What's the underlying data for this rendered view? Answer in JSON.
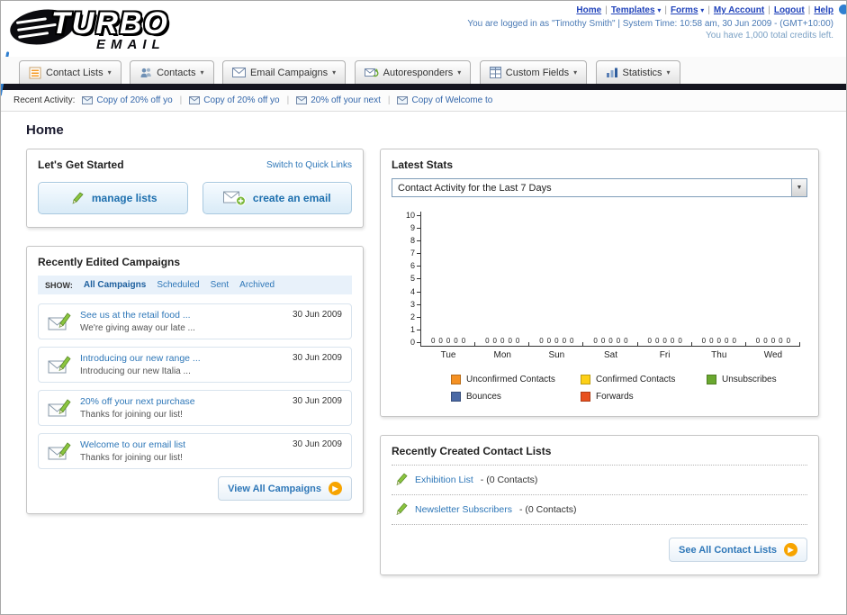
{
  "header": {
    "logo_line1": "TURBO",
    "logo_line2": "EMAIL",
    "nav": {
      "items": [
        "Home",
        "Templates",
        "Forms",
        "My Account",
        "Logout",
        "Help"
      ]
    },
    "login_info": "You are logged in as \"Timothy Smith\" | System Time: 10:58 am, 30 Jun 2009 - (GMT+10:00)",
    "credits": "You have 1,000 total credits left."
  },
  "toolbar": {
    "tabs": [
      {
        "label": "Contact Lists"
      },
      {
        "label": "Contacts"
      },
      {
        "label": "Email Campaigns"
      },
      {
        "label": "Autoresponders"
      },
      {
        "label": "Custom Fields"
      },
      {
        "label": "Statistics"
      }
    ]
  },
  "recent_activity": {
    "label": "Recent Activity:",
    "items": [
      "Copy of 20% off yo",
      "Copy of 20% off yo",
      "20% off your next",
      "Copy of Welcome to"
    ]
  },
  "page": {
    "title": "Home"
  },
  "get_started": {
    "title": "Let's Get Started",
    "switch_link": "Switch to Quick Links",
    "manage_lists_label": "manage lists",
    "create_email_label": "create an email"
  },
  "campaigns": {
    "title": "Recently Edited Campaigns",
    "show_label": "SHOW:",
    "filters": [
      "All Campaigns",
      "Scheduled",
      "Sent",
      "Archived"
    ],
    "active_filter": "All Campaigns",
    "items": [
      {
        "title": "See us at the retail food ...",
        "subtitle": "We're giving away our late ...",
        "date": "30 Jun 2009"
      },
      {
        "title": "Introducing our new range ...",
        "subtitle": "Introducing our new Italia ...",
        "date": "30 Jun 2009"
      },
      {
        "title": "20% off your next purchase",
        "subtitle": "Thanks for joining our list!",
        "date": "30 Jun 2009"
      },
      {
        "title": "Welcome to our email list",
        "subtitle": "Thanks for joining our list!",
        "date": "30 Jun 2009"
      }
    ],
    "view_all_label": "View All Campaigns"
  },
  "stats": {
    "title": "Latest Stats",
    "period_selector": "Contact Activity for the Last 7 Days",
    "chart_data": {
      "type": "bar",
      "title": "Contact Activity for the Last 7 Days",
      "categories": [
        "Tue",
        "Mon",
        "Sun",
        "Sat",
        "Fri",
        "Thu",
        "Wed"
      ],
      "series": [
        {
          "name": "Unconfirmed Contacts",
          "color": "#f59123",
          "values": [
            0,
            0,
            0,
            0,
            0,
            0,
            0
          ]
        },
        {
          "name": "Confirmed Contacts",
          "color": "#fdd017",
          "values": [
            0,
            0,
            0,
            0,
            0,
            0,
            0
          ]
        },
        {
          "name": "Unsubscribes",
          "color": "#6aa82f",
          "values": [
            0,
            0,
            0,
            0,
            0,
            0,
            0
          ]
        },
        {
          "name": "Bounces",
          "color": "#4a69a5",
          "values": [
            0,
            0,
            0,
            0,
            0,
            0,
            0
          ]
        },
        {
          "name": "Forwards",
          "color": "#e8501e",
          "values": [
            0,
            0,
            0,
            0,
            0,
            0,
            0
          ]
        }
      ],
      "ylim": [
        0,
        10
      ],
      "yticks": [
        0,
        1,
        2,
        3,
        4,
        5,
        6,
        7,
        8,
        9,
        10
      ],
      "legend_position": "bottom",
      "grid": false
    }
  },
  "contact_lists": {
    "title": "Recently Created Contact Lists",
    "items": [
      {
        "name": "Exhibition List",
        "count": " - (0 Contacts)"
      },
      {
        "name": "Newsletter Subscribers",
        "count": " - (0 Contacts)"
      }
    ],
    "see_all_label": "See All Contact Lists"
  },
  "colors": {
    "accent_blue": "#2e77b8",
    "nav_bar_dark": "#15151f",
    "button_orange": "#f7a400"
  }
}
